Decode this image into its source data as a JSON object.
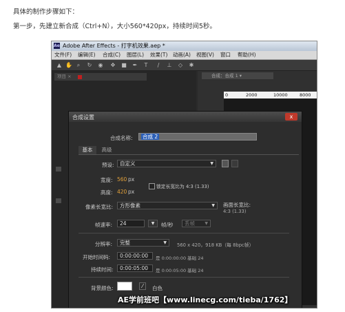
{
  "intro": {
    "line1": "具体的制作步骤如下：",
    "line2": "第一步，先建立新合成（Ctrl+N），大小560*420px，持续时间5秒。"
  },
  "app": {
    "title": "Adobe After Effects - 打字机效果.aep *",
    "logo": "Ae",
    "menu": [
      "文件(F)",
      "编辑(E)",
      "合成(C)",
      "图层(L)",
      "效果(T)",
      "动画(A)",
      "视图(V)",
      "窗口",
      "帮助(H)"
    ],
    "project_tab": "项目 ×",
    "comp_tab": "合成：合成 1 ▾",
    "ruler": [
      "0",
      "2000",
      "10000",
      "8000"
    ]
  },
  "dialog": {
    "title": "合成设置",
    "close": "x",
    "name_label": "合成名称:",
    "name_value": "合成 2",
    "tabs": [
      "基本",
      "高级"
    ],
    "preset_label": "预设:",
    "preset_value": "自定义",
    "width_label": "宽度:",
    "width_value": "560",
    "width_unit": "px",
    "height_label": "高度:",
    "height_value": "420",
    "height_unit": "px",
    "lock_ratio": "锁定长宽比为 4:3 (1.33)",
    "pixel_ratio_label": "像素长宽比:",
    "pixel_ratio_value": "方形像素",
    "frame_ratio_label": "画面长宽比:",
    "frame_ratio_value": "4:3 (1.33)",
    "fps_label": "帧速率:",
    "fps_value": "24",
    "fps_unit": "帧/秒",
    "fps_drop": "丢帧",
    "resolution_label": "分辨率:",
    "resolution_value": "完整",
    "resolution_info": "560 x 420，918 KB（每 8bpc帧）",
    "start_label": "开始时间码:",
    "start_value": "0:00:00:00",
    "start_info": "是 0:00:00:00  基础 24",
    "duration_label": "持续时间:",
    "duration_value": "0:00:05:00",
    "duration_info": "是 0:00:05:00  基础 24",
    "bg_label": "背景颜色:",
    "bg_name": "白色",
    "bg_color": "#ffffff"
  },
  "watermark": "AE学前班吧【www.linecg.com/tieba/1762】"
}
